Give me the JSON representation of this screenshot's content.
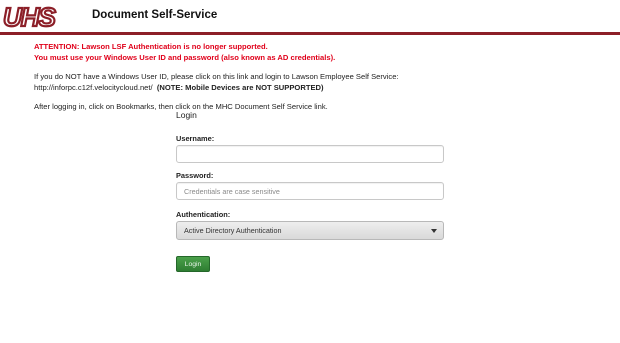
{
  "header": {
    "logo_text": "UHS",
    "app_title": "Document Self-Service",
    "brand_color": "#8c1f28"
  },
  "notice": {
    "attention_line": "ATTENTION:  Lawson LSF Authentication is no longer supported.",
    "credentials_line": "You must use your Windows User ID and password (also known as AD credentials).",
    "no_id_line": "If you do NOT have a Windows User ID, please click on this link and login to Lawson Employee Self Service:",
    "link_url": "http://inforpc.c12f.velocitycloud.net/",
    "mobile_note": "(NOTE:  Mobile Devices are NOT SUPPORTED)",
    "after_login_line": "After logging in, click on Bookmarks, then click on the MHC Document Self Service link.",
    "alert_color": "#e0001a"
  },
  "login": {
    "title": "Login",
    "username_label": "Username:",
    "username_value": "",
    "password_label": "Password:",
    "password_placeholder": "Credentials are case sensitive",
    "auth_label": "Authentication:",
    "auth_selected": "Active Directory Authentication",
    "button_label": "Login",
    "button_color": "#2e7d32"
  }
}
